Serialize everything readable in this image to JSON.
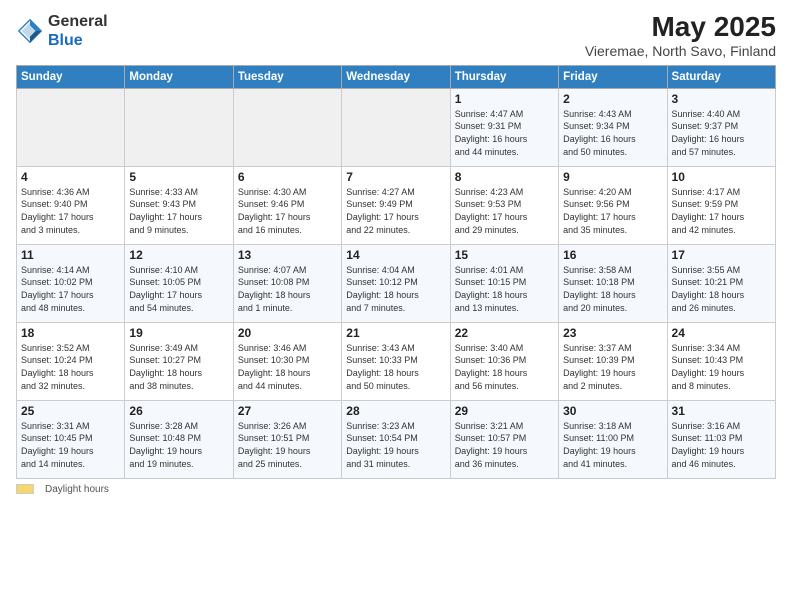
{
  "logo": {
    "text_general": "General",
    "text_blue": "Blue"
  },
  "title": "May 2025",
  "subtitle": "Vieremae, North Savo, Finland",
  "days_of_week": [
    "Sunday",
    "Monday",
    "Tuesday",
    "Wednesday",
    "Thursday",
    "Friday",
    "Saturday"
  ],
  "footer": {
    "label": "Daylight hours"
  },
  "weeks": [
    [
      {
        "day": "",
        "detail": ""
      },
      {
        "day": "",
        "detail": ""
      },
      {
        "day": "",
        "detail": ""
      },
      {
        "day": "",
        "detail": ""
      },
      {
        "day": "1",
        "detail": "Sunrise: 4:47 AM\nSunset: 9:31 PM\nDaylight: 16 hours\nand 44 minutes."
      },
      {
        "day": "2",
        "detail": "Sunrise: 4:43 AM\nSunset: 9:34 PM\nDaylight: 16 hours\nand 50 minutes."
      },
      {
        "day": "3",
        "detail": "Sunrise: 4:40 AM\nSunset: 9:37 PM\nDaylight: 16 hours\nand 57 minutes."
      }
    ],
    [
      {
        "day": "4",
        "detail": "Sunrise: 4:36 AM\nSunset: 9:40 PM\nDaylight: 17 hours\nand 3 minutes."
      },
      {
        "day": "5",
        "detail": "Sunrise: 4:33 AM\nSunset: 9:43 PM\nDaylight: 17 hours\nand 9 minutes."
      },
      {
        "day": "6",
        "detail": "Sunrise: 4:30 AM\nSunset: 9:46 PM\nDaylight: 17 hours\nand 16 minutes."
      },
      {
        "day": "7",
        "detail": "Sunrise: 4:27 AM\nSunset: 9:49 PM\nDaylight: 17 hours\nand 22 minutes."
      },
      {
        "day": "8",
        "detail": "Sunrise: 4:23 AM\nSunset: 9:53 PM\nDaylight: 17 hours\nand 29 minutes."
      },
      {
        "day": "9",
        "detail": "Sunrise: 4:20 AM\nSunset: 9:56 PM\nDaylight: 17 hours\nand 35 minutes."
      },
      {
        "day": "10",
        "detail": "Sunrise: 4:17 AM\nSunset: 9:59 PM\nDaylight: 17 hours\nand 42 minutes."
      }
    ],
    [
      {
        "day": "11",
        "detail": "Sunrise: 4:14 AM\nSunset: 10:02 PM\nDaylight: 17 hours\nand 48 minutes."
      },
      {
        "day": "12",
        "detail": "Sunrise: 4:10 AM\nSunset: 10:05 PM\nDaylight: 17 hours\nand 54 minutes."
      },
      {
        "day": "13",
        "detail": "Sunrise: 4:07 AM\nSunset: 10:08 PM\nDaylight: 18 hours\nand 1 minute."
      },
      {
        "day": "14",
        "detail": "Sunrise: 4:04 AM\nSunset: 10:12 PM\nDaylight: 18 hours\nand 7 minutes."
      },
      {
        "day": "15",
        "detail": "Sunrise: 4:01 AM\nSunset: 10:15 PM\nDaylight: 18 hours\nand 13 minutes."
      },
      {
        "day": "16",
        "detail": "Sunrise: 3:58 AM\nSunset: 10:18 PM\nDaylight: 18 hours\nand 20 minutes."
      },
      {
        "day": "17",
        "detail": "Sunrise: 3:55 AM\nSunset: 10:21 PM\nDaylight: 18 hours\nand 26 minutes."
      }
    ],
    [
      {
        "day": "18",
        "detail": "Sunrise: 3:52 AM\nSunset: 10:24 PM\nDaylight: 18 hours\nand 32 minutes."
      },
      {
        "day": "19",
        "detail": "Sunrise: 3:49 AM\nSunset: 10:27 PM\nDaylight: 18 hours\nand 38 minutes."
      },
      {
        "day": "20",
        "detail": "Sunrise: 3:46 AM\nSunset: 10:30 PM\nDaylight: 18 hours\nand 44 minutes."
      },
      {
        "day": "21",
        "detail": "Sunrise: 3:43 AM\nSunset: 10:33 PM\nDaylight: 18 hours\nand 50 minutes."
      },
      {
        "day": "22",
        "detail": "Sunrise: 3:40 AM\nSunset: 10:36 PM\nDaylight: 18 hours\nand 56 minutes."
      },
      {
        "day": "23",
        "detail": "Sunrise: 3:37 AM\nSunset: 10:39 PM\nDaylight: 19 hours\nand 2 minutes."
      },
      {
        "day": "24",
        "detail": "Sunrise: 3:34 AM\nSunset: 10:43 PM\nDaylight: 19 hours\nand 8 minutes."
      }
    ],
    [
      {
        "day": "25",
        "detail": "Sunrise: 3:31 AM\nSunset: 10:45 PM\nDaylight: 19 hours\nand 14 minutes."
      },
      {
        "day": "26",
        "detail": "Sunrise: 3:28 AM\nSunset: 10:48 PM\nDaylight: 19 hours\nand 19 minutes."
      },
      {
        "day": "27",
        "detail": "Sunrise: 3:26 AM\nSunset: 10:51 PM\nDaylight: 19 hours\nand 25 minutes."
      },
      {
        "day": "28",
        "detail": "Sunrise: 3:23 AM\nSunset: 10:54 PM\nDaylight: 19 hours\nand 31 minutes."
      },
      {
        "day": "29",
        "detail": "Sunrise: 3:21 AM\nSunset: 10:57 PM\nDaylight: 19 hours\nand 36 minutes."
      },
      {
        "day": "30",
        "detail": "Sunrise: 3:18 AM\nSunset: 11:00 PM\nDaylight: 19 hours\nand 41 minutes."
      },
      {
        "day": "31",
        "detail": "Sunrise: 3:16 AM\nSunset: 11:03 PM\nDaylight: 19 hours\nand 46 minutes."
      }
    ]
  ]
}
